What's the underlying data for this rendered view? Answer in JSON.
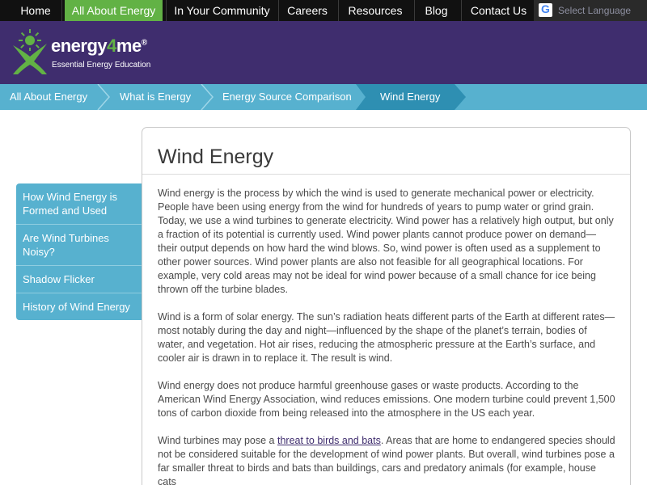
{
  "top_nav": {
    "items": [
      {
        "label": "Home"
      },
      {
        "label": "All About Energy",
        "active": true
      },
      {
        "label": "In Your Community"
      },
      {
        "label": "Careers"
      },
      {
        "label": "Resources"
      },
      {
        "label": "Blog"
      },
      {
        "label": "Contact Us"
      }
    ],
    "translate": {
      "label": "Select Language",
      "icon": "google-g-icon"
    }
  },
  "header": {
    "logo_word_start": "energy",
    "logo_word_four": "4",
    "logo_word_end": "me",
    "logo_reg": "®",
    "tagline": "Essential Energy Education"
  },
  "breadcrumb": {
    "items": [
      {
        "label": "All About Energy"
      },
      {
        "label": "What is Energy"
      },
      {
        "label": "Energy Source Comparison"
      },
      {
        "label": "Wind Energy",
        "current": true
      }
    ]
  },
  "sidebar": {
    "items": [
      {
        "label": "How Wind Energy is Formed and Used"
      },
      {
        "label": "Are Wind Turbines Noisy?"
      },
      {
        "label": "Shadow Flicker"
      },
      {
        "label": "History of Wind Energy"
      }
    ]
  },
  "main": {
    "title": "Wind Energy",
    "paragraphs": [
      "Wind energy is the process by which the wind is used to generate mechanical power or electricity. People have been using energy from the wind for hundreds of years to pump water or grind grain. Today, we use a wind turbines to generate electricity. Wind power has a relatively high output, but only a fraction of its potential is currently used. Wind power plants cannot produce power on demand—their output depends on how hard the wind blows. So, wind power is often used as a supplement to other power sources. Wind power plants are also not feasible for all geographical locations. For example, very cold areas may not be ideal for wind power because of a small chance for ice being thrown off the turbine blades.",
      "Wind is a form of solar energy. The sun’s radiation heats different parts of the Earth at different rates—most notably during the day and night—influenced by the shape of the planet’s terrain, bodies of water, and vegetation. Hot air rises, reducing the atmospheric pressure at the Earth’s surface, and cooler air is drawn in to replace it. The result is wind.",
      "Wind energy does not produce harmful greenhouse gases or waste products. According to the American Wind Energy Association, wind reduces emissions. One modern turbine could prevent 1,500 tons of carbon dioxide from being released into the atmosphere in the US each year."
    ],
    "last_paragraph": {
      "before": "Wind turbines may pose a ",
      "link": "threat to birds and bats",
      "after": ". Areas that are home to endangered species should not be considered suitable for the development of wind power plants. But overall, wind turbines pose a far smaller threat to birds and bats than buildings, cars and predatory animals (for example, house cats"
    }
  },
  "colors": {
    "nav_bg": "#111111",
    "nav_active": "#62b245",
    "header_bg": "#3f2d6e",
    "breadcrumb_bg": "#57b1cf",
    "breadcrumb_current": "#2e8fb2"
  }
}
